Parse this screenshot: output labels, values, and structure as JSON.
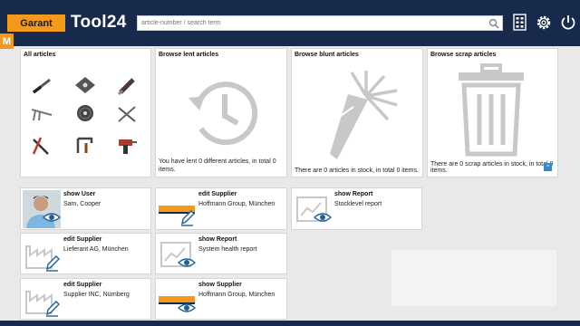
{
  "header": {
    "logo_text": "Garant",
    "app_name": "Tool24",
    "search_placeholder": "article-number / search term",
    "icons": [
      "search-icon",
      "calculator-icon",
      "gear-icon",
      "power-icon"
    ]
  },
  "side_badge": "M",
  "tiles": [
    {
      "title": "All articles",
      "footer": ""
    },
    {
      "title": "Browse lent articles",
      "footer": "You have lent 0 different articles, in total 0 items."
    },
    {
      "title": "Browse blunt articles",
      "footer": "There are 0 articles in stock, in total 0 items."
    },
    {
      "title": "Browse scrap articles",
      "footer": "There are 0 scrap articles in stock, in total 0 items."
    }
  ],
  "cards": [
    {
      "title": "show User",
      "subtitle": "Sam, Cooper",
      "thumb": "user-photo"
    },
    {
      "title": "edit Supplier",
      "subtitle": "Hoffmann Group, München",
      "thumb": "supplier-logo"
    },
    {
      "title": "show Report",
      "subtitle": "Stocklevel report",
      "thumb": "report-icon"
    },
    {
      "title": "edit Supplier",
      "subtitle": "Lieferant AG, München",
      "thumb": "factory-icon"
    },
    {
      "title": "show Report",
      "subtitle": "System health report",
      "thumb": "report-icon"
    },
    {
      "title": "edit Supplier",
      "subtitle": "Supplier INC, Nürnberg",
      "thumb": "factory-icon"
    },
    {
      "title": "show Supplier",
      "subtitle": "Hoffmann Group, München",
      "thumb": "supplier-logo"
    }
  ],
  "colors": {
    "header_bg": "#172a4b",
    "accent": "#f39a1d",
    "icon_blue": "#1f5f9a"
  }
}
